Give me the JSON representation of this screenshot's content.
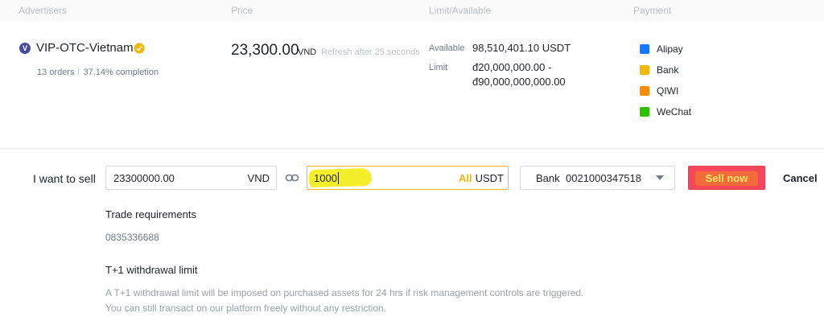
{
  "header": {
    "advertisers": "Advertisers",
    "price": "Price",
    "limit_available": "Limit/Available",
    "payment": "Payment"
  },
  "advertiser": {
    "avatar_letter": "V",
    "name": "VIP-OTC-Vietnam",
    "orders": "13 orders",
    "completion": "37.14% completion",
    "verified_icon": "verified-badge-icon"
  },
  "price": {
    "value": "23,300.00",
    "currency": "VND",
    "refresh_text": "Refresh after 25 seconds"
  },
  "limits": {
    "available_label": "Available",
    "available_value": "98,510,401.10 USDT",
    "limit_label": "Limit",
    "limit_min": "đ20,000,000.00 -",
    "limit_max": "đ90,000,000,000.00"
  },
  "payment_methods": [
    {
      "label": "Alipay",
      "color": "#1677ff",
      "icon": "alipay-icon"
    },
    {
      "label": "Bank",
      "color": "#f0b90b",
      "icon": "bank-icon"
    },
    {
      "label": "QIWI",
      "color": "#ff8c00",
      "icon": "qiwi-icon"
    },
    {
      "label": "WeChat",
      "color": "#2dc100",
      "icon": "wechat-icon"
    }
  ],
  "trade_form": {
    "label": "I want to sell",
    "amount_value": "23300000.00",
    "amount_unit": "VND",
    "link_icon": "link-icon",
    "quantity_value": "1000",
    "all_label": "All",
    "quantity_unit": "USDT",
    "bank_name": "Bank",
    "bank_account": "0021000347518",
    "sell_button": "Sell now",
    "cancel_button": "Cancel"
  },
  "requirements": {
    "title": "Trade requirements",
    "text": "0835336688"
  },
  "withdrawal": {
    "title": "T+1 withdrawal limit",
    "line1": "A T+1 withdrawal limit will be imposed on purchased assets for 24 hrs if risk management controls are triggered.",
    "line2": "You can still transact on our platform freely without any restriction."
  },
  "colors": {
    "accent": "#f0b90b",
    "sell": "#f6465d",
    "highlight": "#f5ee2a"
  }
}
